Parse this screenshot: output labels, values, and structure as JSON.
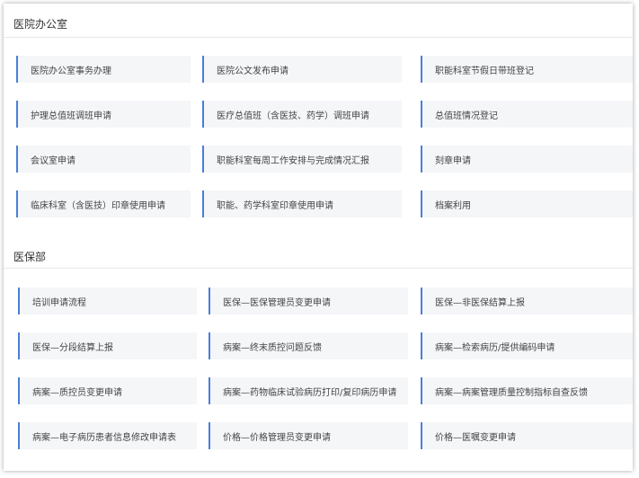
{
  "sections": [
    {
      "title": "医院办公室",
      "items": [
        [
          "医院办公室事务办理",
          "医院公文发布申请",
          "职能科室节假日带班登记"
        ],
        [
          "护理总值班调班申请",
          "医疗总值班（含医技、药学）调班申请",
          "总值班情况登记"
        ],
        [
          "会议室申请",
          "职能科室每周工作安排与完成情况汇报",
          "刻章申请"
        ],
        [
          "临床科室（含医技）印章使用申请",
          "职能、药学科室印章使用申请",
          "档案利用"
        ]
      ]
    },
    {
      "title": "医保部",
      "items": [
        [
          "培训申请流程",
          "医保—医保管理员变更申请",
          "医保—非医保结算上报"
        ],
        [
          "医保—分段结算上报",
          "病案—终末质控问题反馈",
          "病案—检索病历/提供编码申请"
        ],
        [
          "病案—质控员变更申请",
          "病案—药物临床试验病历打印/复印病历申请",
          "病案—病案管理质量控制指标自查反馈"
        ],
        [
          "病案—电子病历患者信息修改申请表",
          "价格—价格管理员变更申请",
          "价格—医嘱变更申请"
        ]
      ]
    }
  ],
  "colors": {
    "accent": "#4a7fd8",
    "card_bg": "#f5f6f8",
    "text": "#444444"
  }
}
